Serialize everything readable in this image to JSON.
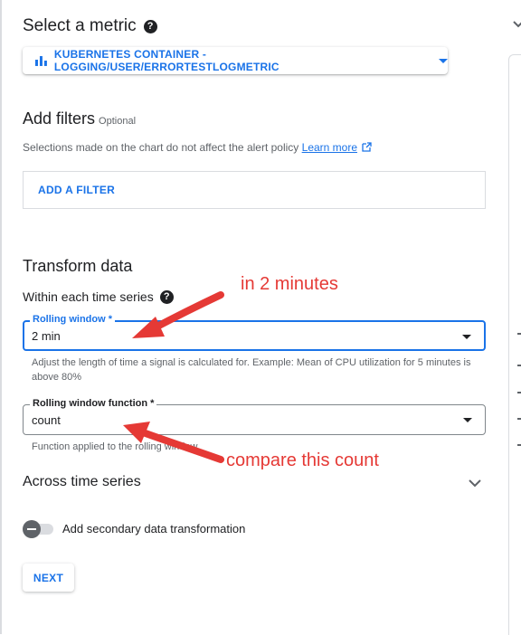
{
  "metric_section": {
    "title": "Select a metric",
    "help_glyph": "?",
    "metric_button_label": "KUBERNETES CONTAINER - LOGGING/USER/ERRORTESTLOGMETRIC"
  },
  "filters_section": {
    "title": "Add filters",
    "optional_label": "Optional",
    "note_text": "Selections made on the chart do not affect the alert policy",
    "learn_more_link": "Learn more",
    "add_filter_button": "ADD A FILTER"
  },
  "transform_section": {
    "title": "Transform data",
    "subtitle": "Within each time series",
    "rolling_window": {
      "label": "Rolling window *",
      "value": "2 min",
      "hint": "Adjust the length of time a signal is calculated for. Example: Mean of CPU utilization for 5 minutes is above 80%"
    },
    "rolling_window_function": {
      "label": "Rolling window function *",
      "value": "count",
      "hint": "Function applied to the rolling window"
    },
    "across_time_series_label": "Across time series",
    "secondary_toggle_label": "Add secondary data transformation",
    "secondary_toggle_on": false
  },
  "next_button": "NEXT",
  "annotations": {
    "note_1": "in 2 minutes",
    "note_2": "compare this count",
    "color": "#e53935"
  },
  "colors": {
    "accent": "#1a73e8",
    "text": "#202124",
    "muted": "#5f6368"
  }
}
